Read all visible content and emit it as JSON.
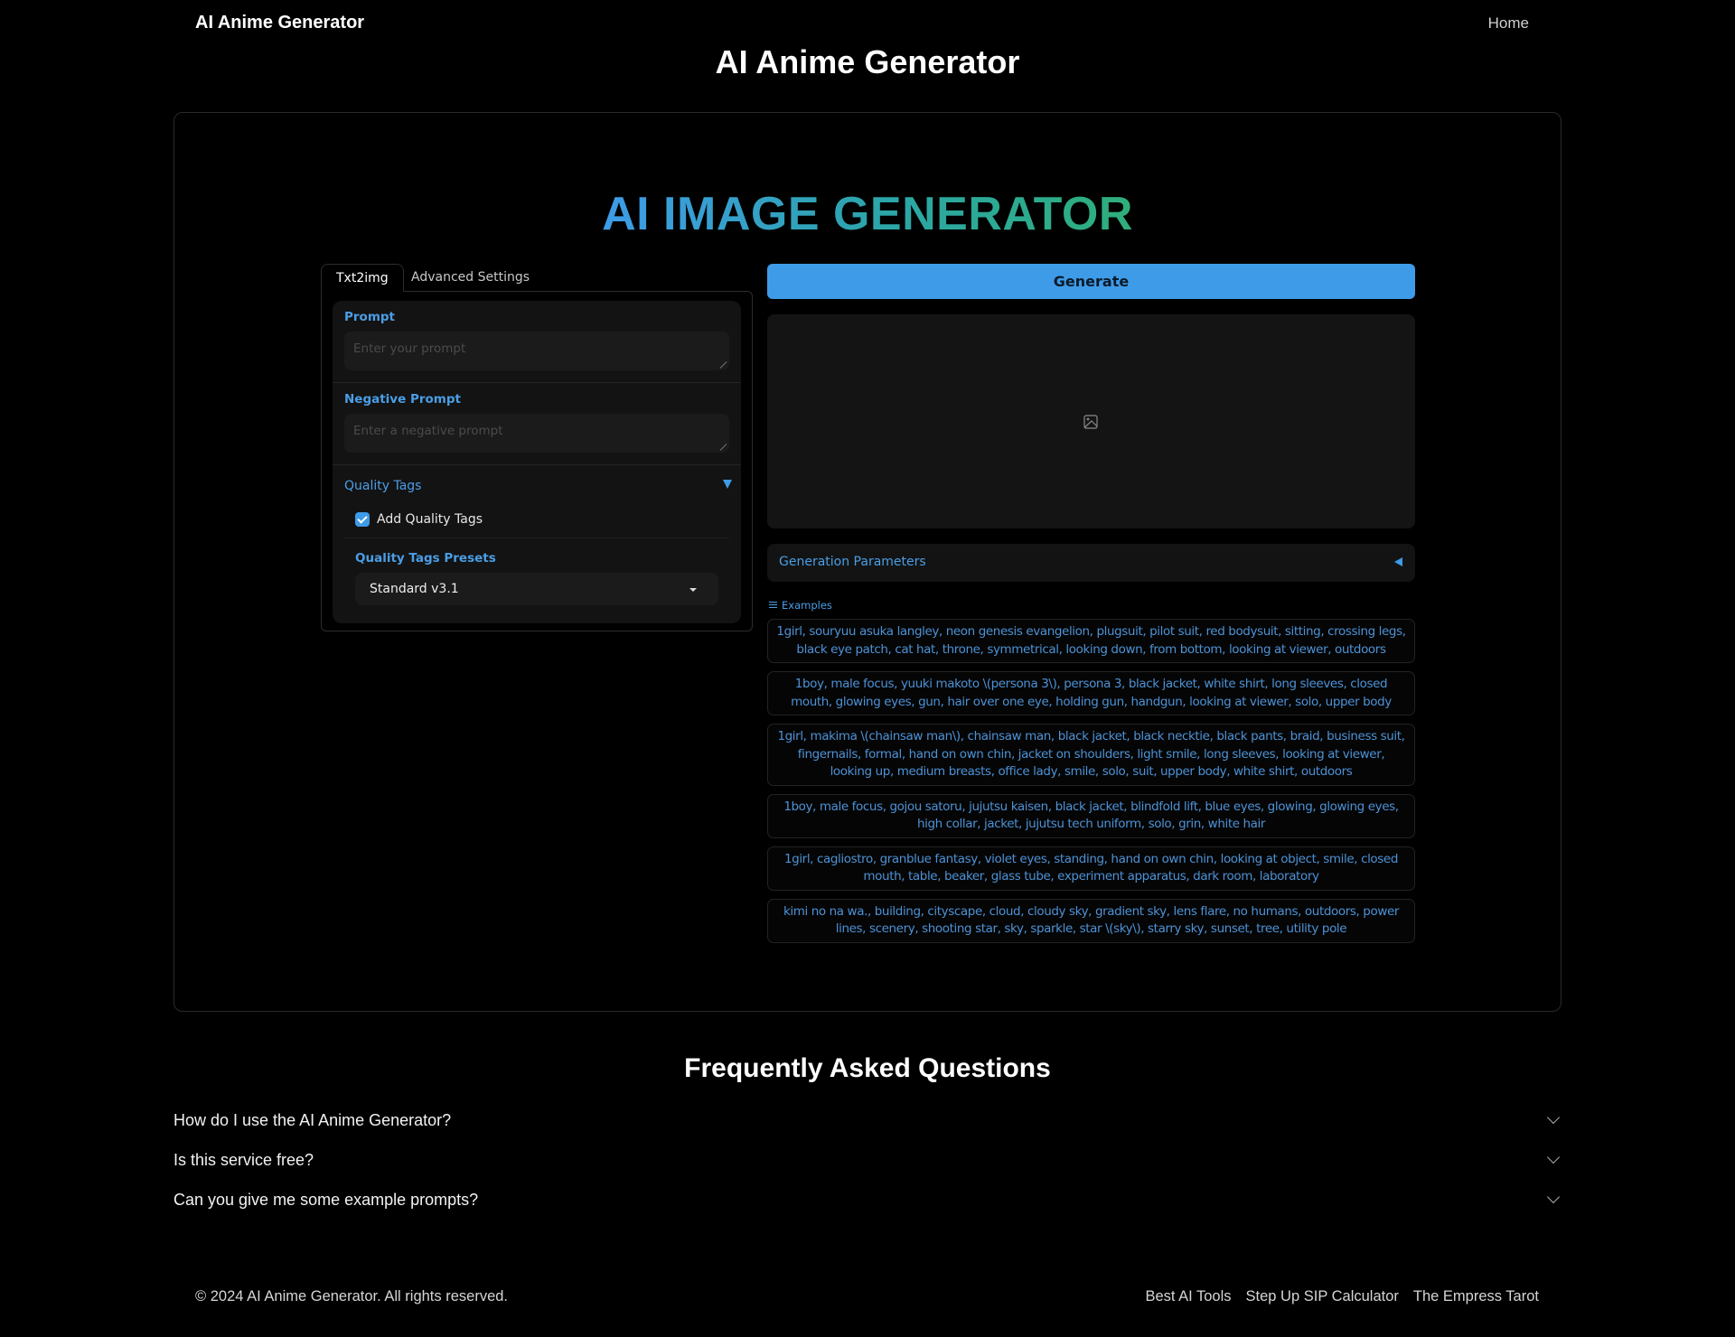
{
  "nav": {
    "brand": "AI Anime Generator",
    "home": "Home"
  },
  "page_title": "AI Anime Generator",
  "hero_title": "AI IMAGE GENERATOR",
  "left_panel": {
    "tabs": [
      {
        "label": "Txt2img",
        "active": true
      },
      {
        "label": "Advanced Settings",
        "active": false
      }
    ],
    "prompt": {
      "label": "Prompt",
      "placeholder": "Enter your prompt",
      "value": ""
    },
    "negative_prompt": {
      "label": "Negative Prompt",
      "placeholder": "Enter a negative prompt",
      "value": ""
    },
    "quality_tags": {
      "title": "Quality Tags",
      "expanded": true,
      "add_quality_tags": {
        "label": "Add Quality Tags",
        "checked": true
      },
      "presets": {
        "label": "Quality Tags Presets",
        "selected": "Standard v3.1"
      }
    }
  },
  "right_panel": {
    "generate_label": "Generate",
    "image_placeholder_icon": "image-icon",
    "generation_parameters": {
      "title": "Generation Parameters",
      "expanded": false
    },
    "examples": {
      "title": "Examples",
      "items": [
        "1girl, souryuu asuka langley, neon genesis evangelion, plugsuit, pilot suit, red bodysuit, sitting, crossing legs, black eye patch, cat hat, throne, symmetrical, looking down, from bottom, looking at viewer, outdoors",
        "1boy, male focus, yuuki makoto \\(persona 3\\), persona 3, black jacket, white shirt, long sleeves, closed mouth, glowing eyes, gun, hair over one eye, holding gun, handgun, looking at viewer, solo, upper body",
        "1girl, makima \\(chainsaw man\\), chainsaw man, black jacket, black necktie, black pants, braid, business suit, fingernails, formal, hand on own chin, jacket on shoulders, light smile, long sleeves, looking at viewer, looking up, medium breasts, office lady, smile, solo, suit, upper body, white shirt, outdoors",
        "1boy, male focus, gojou satoru, jujutsu kaisen, black jacket, blindfold lift, blue eyes, glowing, glowing eyes, high collar, jacket, jujutsu tech uniform, solo, grin, white hair",
        "1girl, cagliostro, granblue fantasy, violet eyes, standing, hand on own chin, looking at object, smile, closed mouth, table, beaker, glass tube, experiment apparatus, dark room, laboratory",
        "kimi no na wa., building, cityscape, cloud, cloudy sky, gradient sky, lens flare, no humans, outdoors, power lines, scenery, shooting star, sky, sparkle, star \\(sky\\), starry sky, sunset, tree, utility pole"
      ]
    }
  },
  "faq": {
    "title": "Frequently Asked Questions",
    "items": [
      {
        "question": "How do I use the AI Anime Generator?"
      },
      {
        "question": "Is this service free?"
      },
      {
        "question": "Can you give me some example prompts?"
      }
    ]
  },
  "footer": {
    "copyright": "© 2024 AI Anime Generator. All rights reserved.",
    "links": [
      "Best AI Tools",
      "Step Up SIP Calculator",
      "The Empress Tarot"
    ]
  },
  "colors": {
    "accent": "#3e9be8",
    "background": "#000000",
    "panel": "#131313"
  }
}
